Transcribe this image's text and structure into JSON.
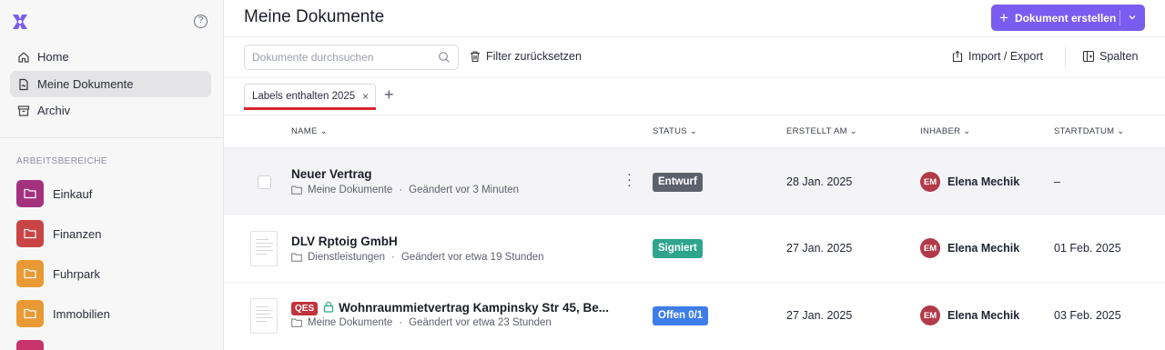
{
  "sidebar": {
    "help_glyph": "?",
    "nav": [
      {
        "label": "Home",
        "icon": "home-icon",
        "active": false
      },
      {
        "label": "Meine Dokumente",
        "icon": "document-icon",
        "active": true
      },
      {
        "label": "Archiv",
        "icon": "archive-icon",
        "active": false
      }
    ],
    "section_label": "ARBEITSBEREICHE",
    "workspaces": [
      {
        "label": "Einkauf",
        "color": "#a4317e"
      },
      {
        "label": "Finanzen",
        "color": "#c94545"
      },
      {
        "label": "Fuhrpark",
        "color": "#e99a35"
      },
      {
        "label": "Immobilien",
        "color": "#e99a35"
      }
    ]
  },
  "header": {
    "title": "Meine Dokumente",
    "create_button": "Dokument erstellen",
    "accent_color": "#7b5cf0"
  },
  "toolbar": {
    "search_placeholder": "Dokumente durchsuchen",
    "reset_filter": "Filter zurücksetzen",
    "import_export": "Import / Export",
    "columns": "Spalten"
  },
  "filter_tabs": {
    "active_chip": "Labels enthalten 2025",
    "close_glyph": "×",
    "add_glyph": "+"
  },
  "table": {
    "headers": {
      "name": "NAME",
      "status": "STATUS",
      "created": "ERSTELLT AM",
      "owner": "INHABER",
      "start": "STARTDATUM"
    },
    "rows": [
      {
        "name": "Neuer Vertrag",
        "folder": "Meine Dokumente",
        "changed": "Geändert vor 3 Minuten",
        "status": "Entwurf",
        "status_color": "#5c626d",
        "created": "28 Jan. 2025",
        "owner_initials": "EM",
        "owner": "Elena Mechik",
        "start": "–"
      },
      {
        "name": "DLV Rptoig GmbH",
        "folder": "Dienstleistungen",
        "changed": "Geändert vor etwa 19 Stunden",
        "status": "Signiert",
        "status_color": "#2ea58c",
        "created": "27 Jan. 2025",
        "owner_initials": "EM",
        "owner": "Elena Mechik",
        "start": "01 Feb. 2025"
      },
      {
        "name": "Wohnraummietvertrag Kampinsky Str 45, Be...",
        "qes_label": "QES",
        "folder": "Meine Dokumente",
        "changed": "Geändert vor etwa 23 Stunden",
        "status": "Offen 0/1",
        "status_color": "#3d7ee8",
        "created": "27 Jan. 2025",
        "owner_initials": "EM",
        "owner": "Elena Mechik",
        "start": "03 Feb. 2025"
      }
    ],
    "separator": "·"
  }
}
